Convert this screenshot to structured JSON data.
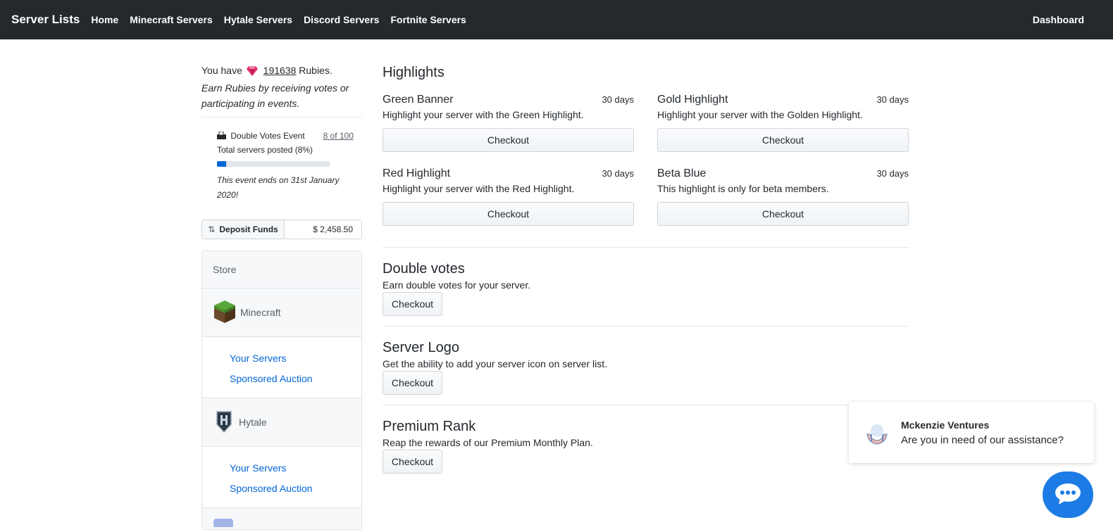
{
  "nav": {
    "brand": "Server Lists",
    "links": [
      "Home",
      "Minecraft Servers",
      "Hytale Servers",
      "Discord Servers",
      "Fortnite Servers"
    ],
    "right": "Dashboard"
  },
  "rubies": {
    "prefix": "You have",
    "count": "191638",
    "suffix": "Rubies.",
    "note": "Earn Rubies by receiving votes or participating in events."
  },
  "event": {
    "title": "Double Votes Event",
    "link": "8 of 100",
    "progress_label": "Total servers posted (8%)",
    "progress_percent": 8,
    "ends": "This event ends on 31st January 2020!"
  },
  "deposit": {
    "button": "Deposit Funds",
    "amount": "$ 2,458.50"
  },
  "store": {
    "header": "Store",
    "games": [
      {
        "name": "Minecraft",
        "links": [
          "Your Servers",
          "Sponsored Auction"
        ]
      },
      {
        "name": "Hytale",
        "links": [
          "Your Servers",
          "Sponsored Auction"
        ]
      }
    ]
  },
  "highlights": {
    "title": "Highlights",
    "items": [
      {
        "name": "Green Banner",
        "days": "30 days",
        "desc": "Highlight your server with the Green Highlight.",
        "button": "Checkout"
      },
      {
        "name": "Gold Highlight",
        "days": "30 days",
        "desc": "Highlight your server with the Golden Highlight.",
        "button": "Checkout"
      },
      {
        "name": "Red Highlight",
        "days": "30 days",
        "desc": "Highlight your server with the Red Highlight.",
        "button": "Checkout"
      },
      {
        "name": "Beta Blue",
        "days": "30 days",
        "desc": "This highlight is only for beta members.",
        "button": "Checkout"
      }
    ]
  },
  "sections": [
    {
      "title": "Double votes",
      "desc": "Earn double votes for your server.",
      "button": "Checkout"
    },
    {
      "title": "Server Logo",
      "desc": "Get the ability to add your server icon on server list.",
      "button": "Checkout"
    },
    {
      "title": "Premium Rank",
      "desc": "Reap the rewards of our Premium Monthly Plan.",
      "button": "Checkout"
    }
  ],
  "chat": {
    "name": "Mckenzie Ventures",
    "message": "Are you in need of our assistance?"
  },
  "colors": {
    "navbar": "#24292e",
    "link": "#0366d6",
    "chat_bubble": "#1c7be5",
    "gem": "#e0306c"
  }
}
